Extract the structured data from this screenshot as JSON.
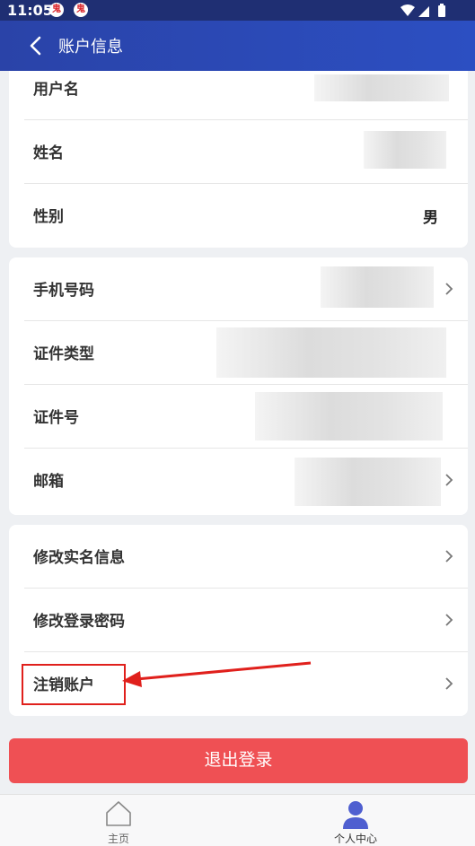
{
  "status": {
    "time": "11:05",
    "notif_glyph": "鬼"
  },
  "header": {
    "title": "账户信息"
  },
  "card1": {
    "username_label": "用户名",
    "name_label": "姓名",
    "gender_label": "性别",
    "gender_value": "男"
  },
  "card2": {
    "phone_label": "手机号码",
    "idtype_label": "证件类型",
    "idnum_label": "证件号",
    "email_label": "邮箱"
  },
  "card3": {
    "modify_realname_label": "修改实名信息",
    "modify_password_label": "修改登录密码",
    "cancel_account_label": "注销账户"
  },
  "logout_label": "退出登录",
  "tabs": {
    "home": "主页",
    "profile": "个人中心"
  },
  "colors": {
    "accent": "#2c4fc2",
    "danger": "#ef5054",
    "active_tab": "#4f5fd0",
    "annotation": "#e0201c"
  }
}
